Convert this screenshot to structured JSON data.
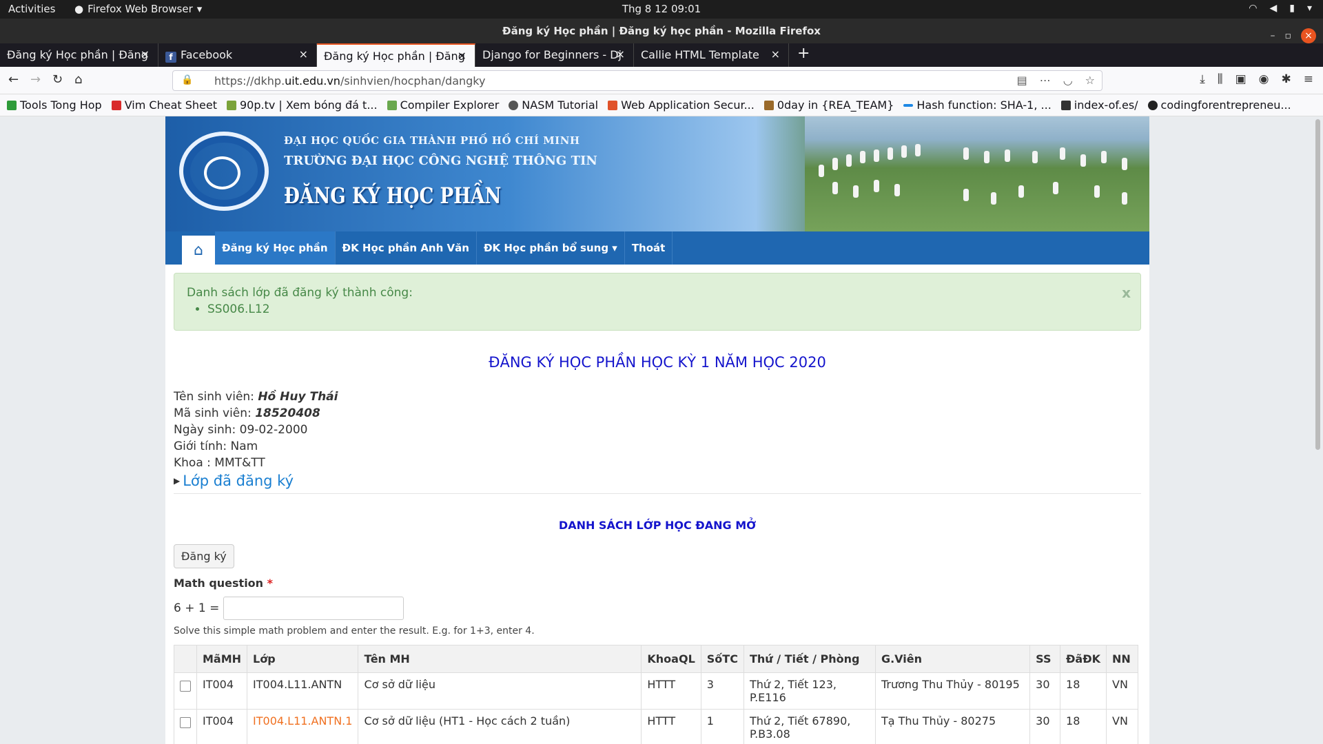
{
  "system": {
    "activities": "Activities",
    "app_name": "Firefox Web Browser",
    "clock": "Thg 8 12  09:01"
  },
  "window": {
    "title": "Đăng ký Học phần | Đăng ký học phần - Mozilla Firefox"
  },
  "tabs": [
    {
      "label": "Đăng ký Học phần | Đăng",
      "active": false
    },
    {
      "label": "Facebook",
      "active": false
    },
    {
      "label": "Đăng ký Học phần | Đăng",
      "active": true
    },
    {
      "label": "Django for Beginners - Dj",
      "active": false
    },
    {
      "label": "Callie HTML Template",
      "active": false
    }
  ],
  "url": {
    "prefix": "https://dkhp.",
    "domain": "uit.edu.vn",
    "path": "/sinhvien/hocphan/dangky"
  },
  "bookmarks": [
    {
      "label": "Tools Tong Hop",
      "color": "#2e9b3a"
    },
    {
      "label": "Vim Cheat Sheet",
      "color": "#d92b2b"
    },
    {
      "label": "90p.tv | Xem bóng đá t...",
      "color": "#7ba33a"
    },
    {
      "label": "Compiler Explorer",
      "color": "#6aa84f"
    },
    {
      "label": "NASM Tutorial",
      "color": "#555555"
    },
    {
      "label": "Web Application Secur...",
      "color": "#e0522a"
    },
    {
      "label": "0day in {REA_TEAM}",
      "color": "#9a6a2a"
    },
    {
      "label": "Hash function: SHA-1, ...",
      "color": "#1e88e5"
    },
    {
      "label": "index-of.es/",
      "color": "#333333"
    },
    {
      "label": "codingforentrepreneu...",
      "color": "#222222"
    }
  ],
  "banner": {
    "line1": "ĐẠI HỌC QUỐC GIA THÀNH PHỐ HỒ CHÍ MINH",
    "line2": "TRƯỜNG ĐẠI HỌC CÔNG NGHỆ THÔNG TIN",
    "line3": "ĐĂNG KÝ HỌC PHẦN"
  },
  "menu": {
    "items": [
      "Đăng ký Học phần",
      "ĐK Học phần Anh Văn",
      "ĐK Học phần bổ sung ▾",
      "Thoát"
    ]
  },
  "alert": {
    "message": "Danh sách lớp đã đăng ký thành công:",
    "item": "SS006.L12",
    "close": "x"
  },
  "heading": "ĐĂNG KÝ HỌC PHẦN HỌC KỲ 1 NĂM HỌC 2020",
  "student": {
    "name_label": "Tên sinh viên:",
    "name": "Hồ Huy Thái",
    "id_label": "Mã sinh viên:",
    "id": "18520408",
    "dob": "Ngày sinh: 09-02-2000",
    "gender": "Giới tính: Nam",
    "faculty": "Khoa : MMT&TT"
  },
  "registered_link": "Lớp đã đăng ký",
  "open_title": "DANH SÁCH LỚP HỌC ĐANG MỞ",
  "register_button": "Đăng ký",
  "math": {
    "label": "Math question",
    "required": "*",
    "question": "6 + 1 =",
    "hint": "Solve this simple math problem and enter the result. E.g. for 1+3, enter 4."
  },
  "table": {
    "headers": [
      "",
      "MãMH",
      "Lớp",
      "Tên MH",
      "KhoaQL",
      "SốTC",
      "Thứ / Tiết / Phòng",
      "G.Viên",
      "SS",
      "ĐãĐK",
      "NN"
    ],
    "rows": [
      [
        "IT004",
        "IT004.L11.ANTN",
        "Cơ sở dữ liệu",
        "HTTT",
        "3",
        "Thứ 2, Tiết 123, P.E116",
        "Trương Thu Thủy - 80195",
        "30",
        "18",
        "VN"
      ],
      [
        "IT004",
        "IT004.L11.ANTN.1",
        "Cơ sở dữ liệu (HT1 - Học cách 2 tuần)",
        "HTTT",
        "1",
        "Thứ 2, Tiết 67890, P.B3.08",
        "Tạ Thu Thủy - 80275",
        "30",
        "18",
        "VN"
      ]
    ]
  }
}
